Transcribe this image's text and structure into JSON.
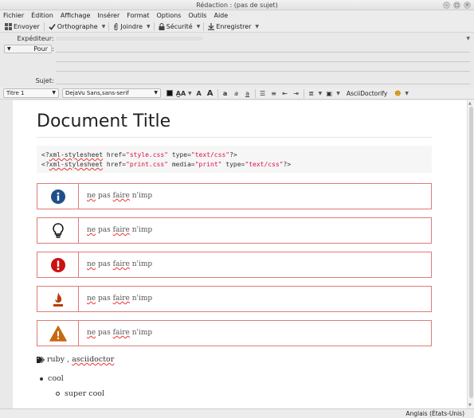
{
  "window": {
    "title": "Rédaction : (pas de sujet)"
  },
  "menubar": [
    "Fichier",
    "Édition",
    "Affichage",
    "Insérer",
    "Format",
    "Options",
    "Outils",
    "Aide"
  ],
  "toolbar": {
    "send": "Envoyer",
    "spelling": "Orthographe",
    "attach": "Joindre",
    "security": "Sécurité",
    "save": "Enregistrer"
  },
  "header": {
    "from_label": "Expéditeur",
    "to_label": "Pour",
    "subject_label": "Sujet"
  },
  "format_bar": {
    "paragraph_style": "Titre 1",
    "font": "DejaVu Sans,sans-serif",
    "text_color": "#111111",
    "asciidoctorify": "AsciiDoctorify"
  },
  "document": {
    "title": "Document Title",
    "code_lines": [
      {
        "prefix": "<?",
        "pi": "xml-stylesheet",
        "attrs": [
          {
            "name": "href",
            "value": "\"style.css\""
          },
          {
            "name": "type",
            "value": "\"text/css\""
          }
        ],
        "suffix": "?>"
      },
      {
        "prefix": "<?",
        "pi": "xml-stylesheet",
        "attrs": [
          {
            "name": "href",
            "value": "\"print.css\""
          },
          {
            "name": "media",
            "value": "\"print\""
          },
          {
            "name": "type",
            "value": "\"text/css\""
          }
        ],
        "suffix": "?>"
      }
    ],
    "admonitions": [
      {
        "icon": "info-icon",
        "text_parts": [
          "ne",
          "pas",
          "faire",
          "n'imp"
        ]
      },
      {
        "icon": "lightbulb-icon",
        "text_parts": [
          "ne",
          "pas",
          "faire",
          "n'imp"
        ]
      },
      {
        "icon": "important-icon",
        "text_parts": [
          "ne",
          "pas",
          "faire",
          "n'imp"
        ]
      },
      {
        "icon": "caution-flame-icon",
        "text_parts": [
          "ne",
          "pas",
          "faire",
          "n'imp"
        ]
      },
      {
        "icon": "warning-icon",
        "text_parts": [
          "ne",
          "pas",
          "faire",
          "n'imp"
        ]
      }
    ],
    "tags": [
      "ruby",
      "asciidoctor"
    ],
    "list": {
      "item": "cool",
      "subitem": "super cool"
    }
  },
  "status": {
    "language": "Anglais (États-Unis)"
  },
  "colors": {
    "admonition_border": "#e07a7a",
    "info_blue": "#1e4f8c",
    "important_red": "#cc1111",
    "warning_orange": "#c66a10"
  }
}
